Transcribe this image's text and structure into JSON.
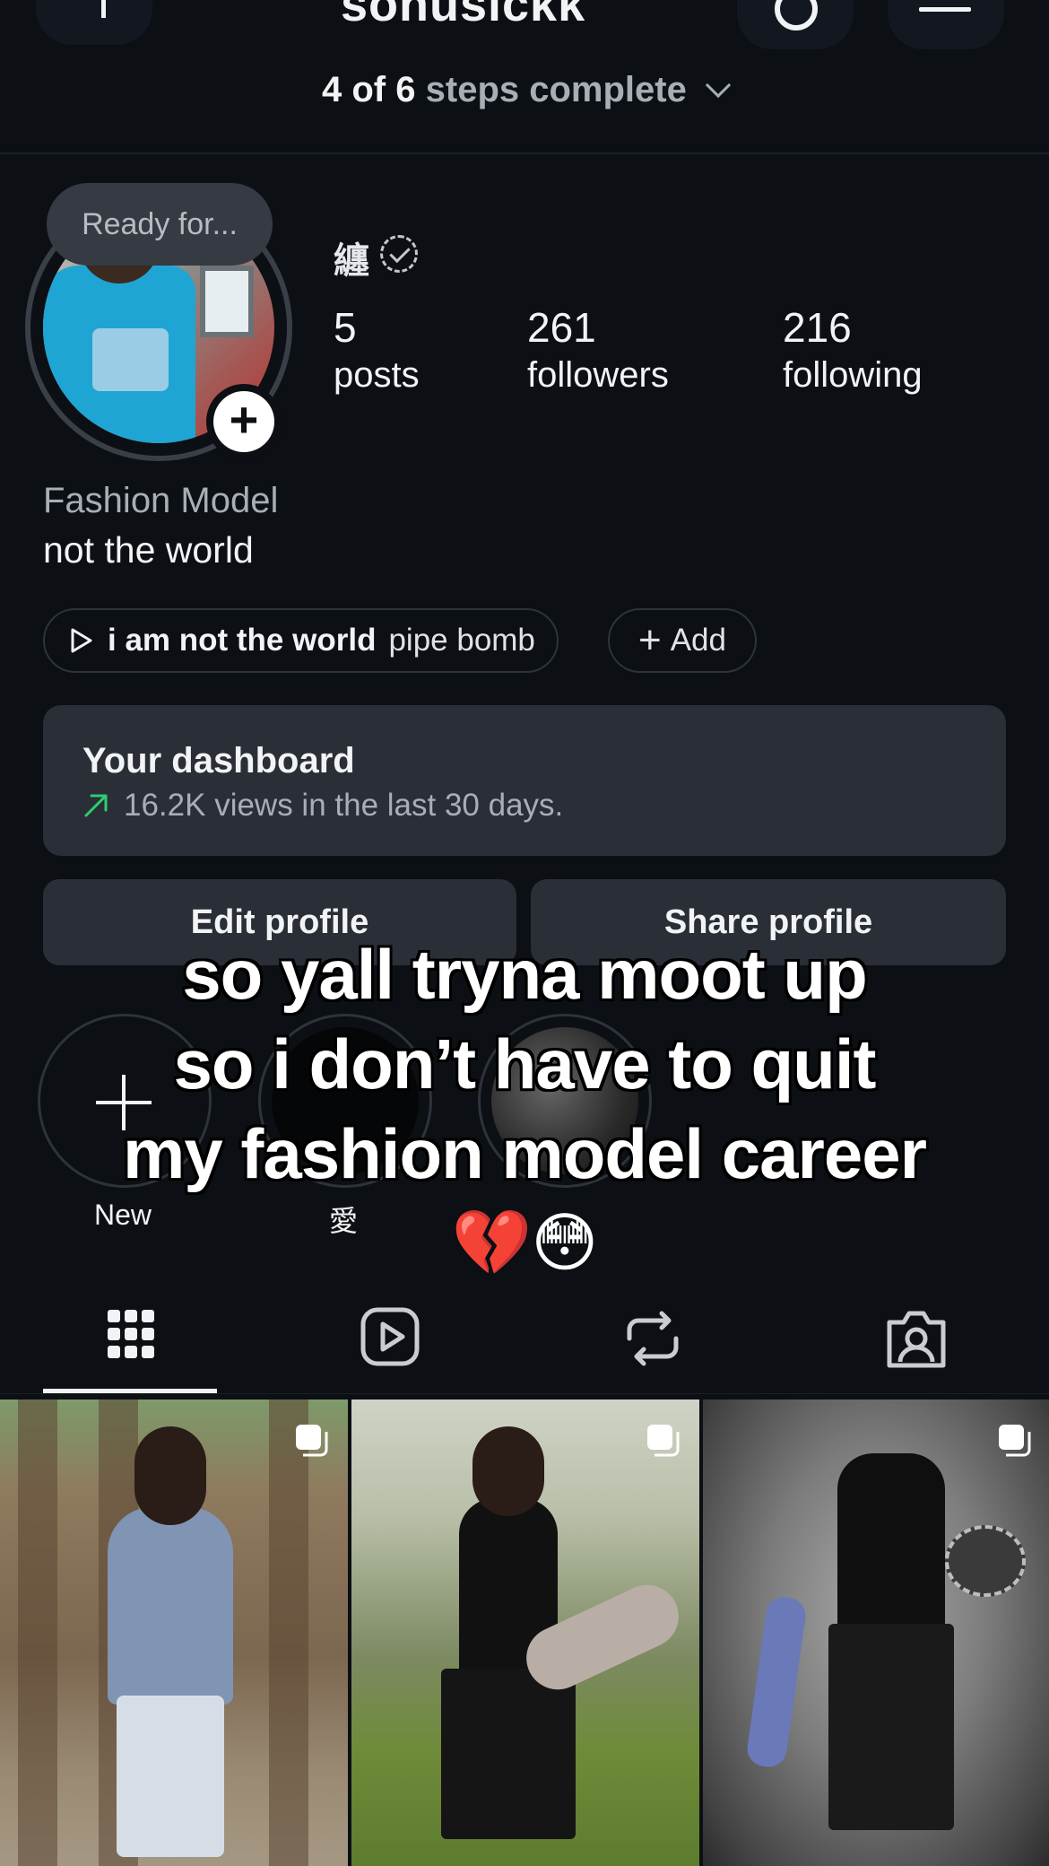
{
  "header": {
    "username": "sonusickk",
    "steps_count": "4 of 6",
    "steps_rest": "steps complete"
  },
  "profile": {
    "note": "Ready for...",
    "name_glyph": "纏",
    "stats": [
      {
        "value": "5",
        "label": "posts"
      },
      {
        "value": "261",
        "label": "followers"
      },
      {
        "value": "216",
        "label": "following"
      }
    ],
    "category": "Fashion Model",
    "bio": "not the world"
  },
  "music": {
    "title": "i am not the world",
    "artist": "pipe bomb",
    "add_label": "Add"
  },
  "dashboard": {
    "title": "Your dashboard",
    "subtitle": "16.2K views in the last 30 days.",
    "trend_color": "#2ecc71"
  },
  "actions": {
    "edit_label": "Edit profile",
    "share_label": "Share profile"
  },
  "highlights": [
    {
      "label": "New"
    },
    {
      "label": "愛"
    },
    {
      "label": ""
    }
  ],
  "caption": {
    "lines": [
      "so yall tryna moot up",
      "so i don’t have to quit",
      "my fashion model career"
    ],
    "emoji": "💔😳"
  },
  "tabs": [
    "grid-icon",
    "reels-icon",
    "reposts-icon",
    "tagged-icon"
  ],
  "posts": [
    {
      "kind": "carousel"
    },
    {
      "kind": "carousel"
    },
    {
      "kind": "carousel"
    }
  ]
}
